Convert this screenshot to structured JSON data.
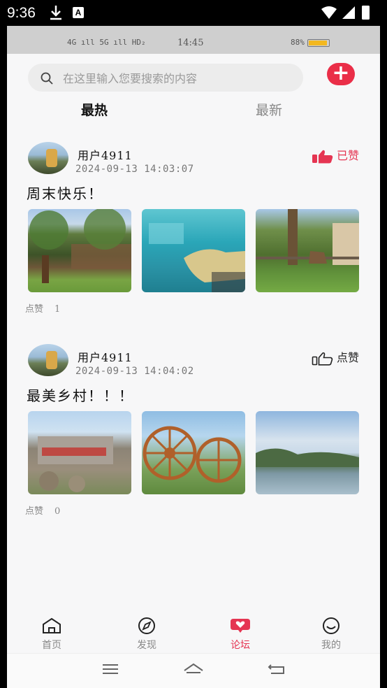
{
  "status_bar": {
    "time": "9:36",
    "a_badge": "A"
  },
  "inner_status": {
    "network": "4G ıll 5G ıll HD₂",
    "clock": "14:45",
    "battery": "88%"
  },
  "search": {
    "placeholder": "在这里输入您要搜索的内容"
  },
  "add_button": {
    "symbol": "+"
  },
  "tabs": [
    {
      "label": "最热"
    },
    {
      "label": "最新"
    }
  ],
  "posts": [
    {
      "user": "用户4911",
      "time": "2024-09-13 14:03:07",
      "content": "周末快乐！",
      "like_label": "已赞",
      "liked": true,
      "likes_label": "点赞",
      "likes": "1"
    },
    {
      "user": "用户4911",
      "time": "2024-09-13 14:04:02",
      "content": "最美乡村！！！",
      "like_label": "点赞",
      "liked": false,
      "likes_label": "点赞",
      "likes": "0"
    }
  ],
  "nav": [
    {
      "label": "首页",
      "icon": "home-icon"
    },
    {
      "label": "发现",
      "icon": "compass-icon"
    },
    {
      "label": "论坛",
      "icon": "forum-icon",
      "active": true
    },
    {
      "label": "我的",
      "icon": "smiley-icon"
    }
  ],
  "colors": {
    "accent": "#e53552",
    "add_button": "#ea2e48",
    "background": "#f7f7f8"
  }
}
